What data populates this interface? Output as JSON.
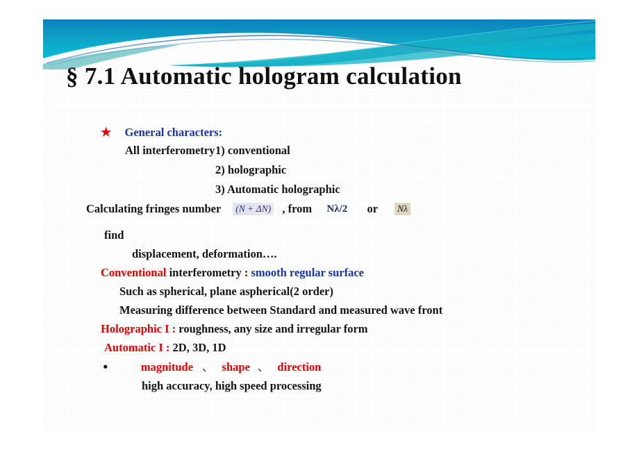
{
  "slide": {
    "title": "§ 7.1  Automatic hologram calculation",
    "header_colors": {
      "gradient_top": "#0a86bd",
      "gradient_bottom": "#00c9dc",
      "teal": "#12a8bf",
      "deep_blue": "#1c6fb0"
    },
    "bullet_star": "★",
    "bullet_dot": "•",
    "heading": "General characters:",
    "heading_color": "#1734a8",
    "lines": {
      "all_interferometry": "All interferometry",
      "item1": "1)  conventional",
      "item2": "2)  holographic",
      "item3": "3)  Automatic holographic",
      "calculating": "Calculating fringes number",
      "eq_fringe": "(N + ΔN)",
      "comma_from": ", from",
      "eq_half": "Nλ/2",
      "or": "or",
      "eq_nl": "Nλ",
      "find": "find",
      "displacement": "displacement, deformation….",
      "conventional_label": "Conventional",
      "conventional_mid": " interferometry : ",
      "conventional_tail": "smooth  regular surface",
      "such_as": "Such as spherical, plane aspherical(2 order)",
      "measuring": "Measuring difference between  Standard and measured wave front",
      "holographic_label": "Holographic  I :",
      "holographic_tail": " roughness, any size and irregular form",
      "automatic_label": "Automatic  I :",
      "automatic_tail": " 2D, 3D, 1D",
      "magnitude": "magnitude",
      "sep1": "、",
      "shape": "shape",
      "sep2": "、",
      "direction": "direction",
      "high_accuracy": "high accuracy, high speed processing"
    }
  }
}
